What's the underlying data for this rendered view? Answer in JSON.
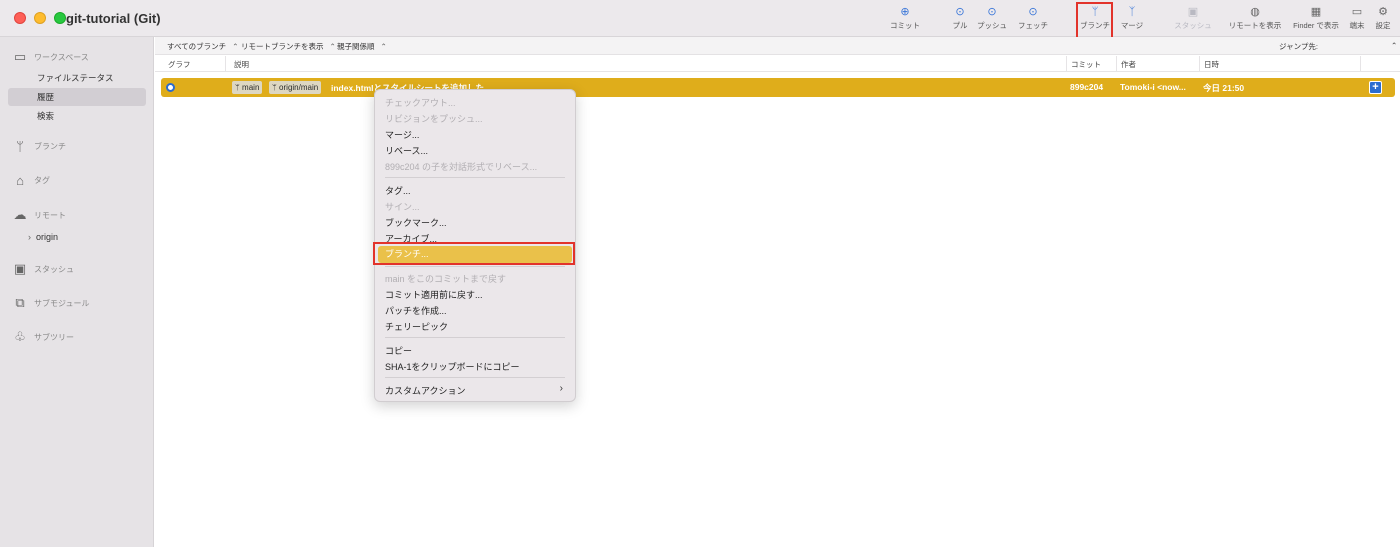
{
  "window": {
    "title": "git-tutorial (Git)"
  },
  "toolbar": {
    "commit": "コミット",
    "pull": "プル",
    "push": "プッシュ",
    "fetch": "フェッチ",
    "branch": "ブランチ",
    "merge": "マージ",
    "stash": "スタッシュ",
    "show_remote": "リモートを表示",
    "show_in_finder": "Finder で表示",
    "terminal": "端末",
    "settings": "設定",
    "icons": {
      "commit": "plus-circle-icon",
      "pull": "arrow-down-circle-icon",
      "push": "arrow-up-circle-icon",
      "fetch": "arrow-down-dashed-circle-icon",
      "branch": "branch-icon",
      "merge": "merge-icon",
      "stash": "stash-icon",
      "show_remote": "globe-icon",
      "show_in_finder": "finder-icon",
      "terminal": "terminal-icon",
      "settings": "gear-icon"
    }
  },
  "sidebar": {
    "workspace": "ワークスペース",
    "file_status": "ファイルステータス",
    "history": "履歴",
    "search": "検索",
    "branches": "ブランチ",
    "tags": "タグ",
    "remotes": "リモート",
    "origin": "origin",
    "stash": "スタッシュ",
    "submodules": "サブモジュール",
    "subtrees": "サブツリー"
  },
  "filters": {
    "branches": "すべてのブランチ",
    "remote": "リモートブランチを表示",
    "order": "親子関係順",
    "jump_to": "ジャンプ先:"
  },
  "columns": {
    "graph": "グラフ",
    "description": "説明",
    "commit": "コミット",
    "author": "作者",
    "date": "日時"
  },
  "commit_row": {
    "tags": [
      "main",
      "origin/main"
    ],
    "message": "index.htmlとスタイルシートを追加した",
    "sha": "899c204",
    "author": "Tomoki-i <now...",
    "date": "今日 21:50",
    "plus": "+"
  },
  "context_menu": {
    "checkout": "チェックアウト...",
    "push_revision": "リビジョンをプッシュ...",
    "merge": "マージ...",
    "rebase": "リベース...",
    "interactive_rebase": "899c204 の子を対話形式でリベース...",
    "tag": "タグ...",
    "sign": "サイン...",
    "bookmark": "ブックマーク...",
    "archive": "アーカイブ...",
    "branch": "ブランチ...",
    "reset": "main をこのコミットまで戻す",
    "revert": "コミット適用前に戻す...",
    "create_patch": "パッチを作成...",
    "cherry_pick": "チェリーピック",
    "copy": "コピー",
    "copy_sha": "SHA-1をクリップボードにコピー",
    "custom_actions": "カスタムアクション"
  },
  "colors": {
    "row_highlight": "#dfad1b",
    "menu_highlight": "#eac14a",
    "annotation_red": "#e2332b",
    "accent_blue": "#3a76d8"
  }
}
